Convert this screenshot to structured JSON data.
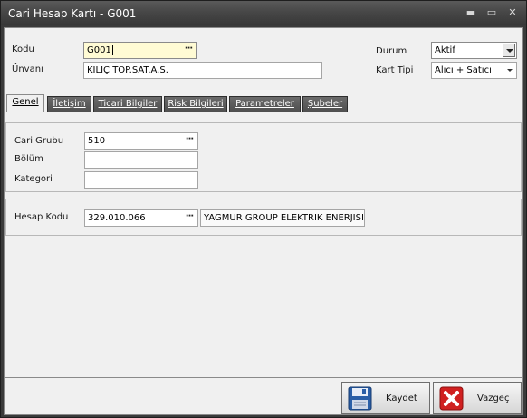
{
  "window": {
    "title": "Cari Hesap Kartı - G001",
    "minimize_glyph": "▬",
    "maximize_glyph": "▭",
    "close_glyph": "✕"
  },
  "header": {
    "kod_label": "Kodu",
    "kod_value": "G001",
    "unvan_label": "Ünvanı",
    "unvan_value": "KILIÇ TOP.SAT.A.S.",
    "durum_label": "Durum",
    "durum_value": "Aktif",
    "kart_tipi_label": "Kart Tipi",
    "kart_tipi_value": "Alıcı + Satıcı"
  },
  "tabs": [
    {
      "label": "Genel",
      "active": true
    },
    {
      "label": "İletişim",
      "active": false
    },
    {
      "label": "Ticari Bilgiler",
      "active": false
    },
    {
      "label": "Risk Bilgileri",
      "active": false
    },
    {
      "label": "Parametreler",
      "active": false
    },
    {
      "label": "Şubeler",
      "active": false
    }
  ],
  "genel": {
    "cari_grubu_label": "Cari Grubu",
    "cari_grubu_value": "510",
    "bolum_label": "Bölüm",
    "bolum_value": "",
    "kategori_label": "Kategori",
    "kategori_value": "",
    "hesap_kodu_label": "Hesap Kodu",
    "hesap_kodu_value": "329.010.066",
    "hesap_adi_value": "YAGMUR GROUP ELEKTRIK ENERJISI"
  },
  "lookup_glyph": "···",
  "buttons": {
    "save_label": "Kaydet",
    "cancel_label": "Vazgeç"
  },
  "colors": {
    "active_field_bg": "#fffbd4",
    "save_icon": "#2a5fa8",
    "cancel_icon": "#d02020"
  },
  "icons": {
    "save": "floppy-disk-icon",
    "cancel": "red-x-icon"
  }
}
